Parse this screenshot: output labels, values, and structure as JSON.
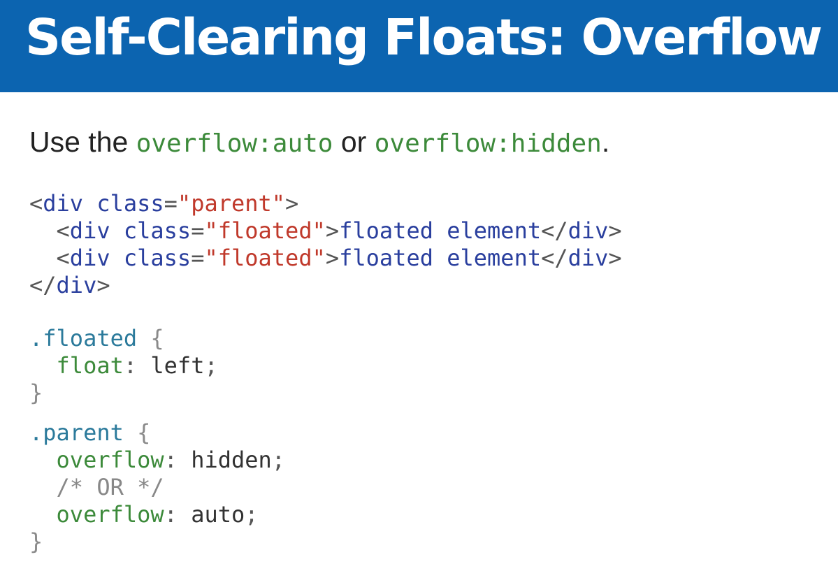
{
  "title": "Self-Clearing Floats: Overflow",
  "intro": {
    "prefix": "Use the ",
    "code1": "overflow:auto",
    "middle": " or ",
    "code2": "overflow:hidden",
    "suffix": "."
  },
  "html_code": {
    "lt": "<",
    "gt": ">",
    "close_open": "</",
    "div": "div",
    "class_attr": " class",
    "equals": "=",
    "parent_class": "\"parent\"",
    "floated_class": "\"floated\"",
    "child_text": "floated element",
    "indent": "  "
  },
  "css_code": {
    "floated_selector": ".floated",
    "parent_selector": ".parent",
    "open_brace": " {",
    "close_brace": "}",
    "float_prop": "float",
    "float_val": "left",
    "overflow_prop": "overflow",
    "hidden_val": "hidden",
    "auto_val": "auto",
    "colon": ": ",
    "semicolon": ";",
    "comment": "/* OR */",
    "indent": "  "
  },
  "colors": {
    "header": "#0c64b0",
    "code_green": "#3c8a3a",
    "tag_blue": "#2a3f9e",
    "string_red": "#c0392b",
    "selector_teal": "#2b7a9b"
  }
}
